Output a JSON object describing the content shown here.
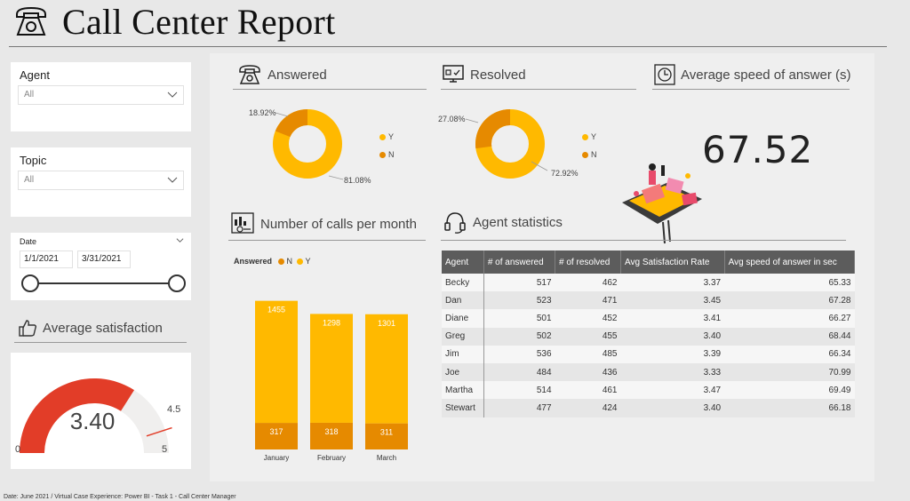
{
  "header": {
    "title": "Call Center Report"
  },
  "filters": {
    "agent": {
      "label": "Agent",
      "value": "All"
    },
    "topic": {
      "label": "Topic",
      "value": "All"
    },
    "date": {
      "label": "Date",
      "start": "1/1/2021",
      "end": "3/31/2021"
    }
  },
  "satisfaction": {
    "title": "Average satisfaction",
    "value": "3.40",
    "min": "0",
    "max": "5",
    "target": "4.5",
    "fraction": 0.68,
    "target_fraction": 0.9
  },
  "answered": {
    "title": "Answered",
    "pct_small": "18.92%",
    "pct_large": "81.08%",
    "legend": [
      "Y",
      "N"
    ]
  },
  "resolved": {
    "title": "Resolved",
    "pct_small": "27.08%",
    "pct_large": "72.92%",
    "legend": [
      "Y",
      "N"
    ]
  },
  "speed": {
    "title": "Average speed of answer (s)",
    "value": "67.52"
  },
  "calls_chart": {
    "title": "Number of calls per month",
    "legend_title": "Answered",
    "legend": [
      "N",
      "Y"
    ]
  },
  "agent_stats": {
    "title": "Agent statistics",
    "columns": [
      "Agent",
      "# of answered",
      "# of resolved",
      "Avg Satisfaction Rate",
      "Avg speed of answer in sec"
    ],
    "rows": [
      [
        "Becky",
        "517",
        "462",
        "3.37",
        "65.33"
      ],
      [
        "Dan",
        "523",
        "471",
        "3.45",
        "67.28"
      ],
      [
        "Diane",
        "501",
        "452",
        "3.41",
        "66.27"
      ],
      [
        "Greg",
        "502",
        "455",
        "3.40",
        "68.44"
      ],
      [
        "Jim",
        "536",
        "485",
        "3.39",
        "66.34"
      ],
      [
        "Joe",
        "484",
        "436",
        "3.33",
        "70.99"
      ],
      [
        "Martha",
        "514",
        "461",
        "3.47",
        "69.49"
      ],
      [
        "Stewart",
        "477",
        "424",
        "3.40",
        "66.18"
      ]
    ]
  },
  "footer": "Date: June 2021 / Virtual Case Experience: Power BI - Task 1 - Call Center Manager",
  "colors": {
    "yellow": "#FFB900",
    "orange": "#E68A00",
    "red": "#E23D28",
    "gray": "#f0f0f0"
  },
  "chart_data": {
    "type": "bar",
    "stacked": true,
    "categories": [
      "January",
      "February",
      "March"
    ],
    "series": [
      {
        "name": "N",
        "values": [
          317,
          318,
          311
        ]
      },
      {
        "name": "Y",
        "values": [
          1455,
          1298,
          1301
        ]
      }
    ],
    "title": "Number of calls per month",
    "legend_title": "Answered"
  }
}
